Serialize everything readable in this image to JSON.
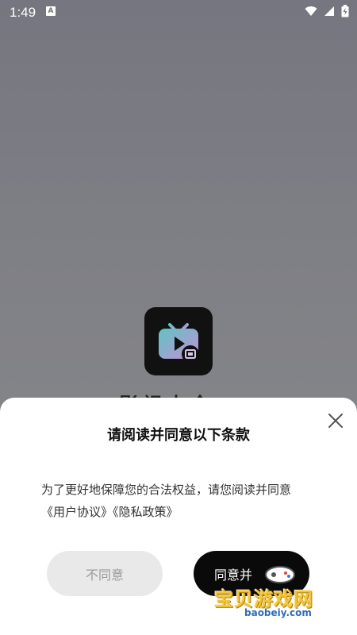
{
  "status_bar": {
    "time": "1:49",
    "notification_icon": "a-square-icon",
    "wifi_icon": "wifi-icon",
    "signal_icon": "signal-icon",
    "battery_icon": "battery-charging-icon"
  },
  "splash": {
    "app_icon": "tv-play-icon",
    "app_name_partial": "影视大全"
  },
  "dialog": {
    "title": "请阅读并同意以下条款",
    "body_line1": "为了更好地保障您的合法权益，请您阅读并同意",
    "link_user_agreement": "《用户协议》",
    "link_privacy_policy": "《隐私政策》",
    "disagree_label": "不同意",
    "agree_label": "同意并",
    "close_icon": "close-icon"
  },
  "watermark": {
    "title": "宝贝游戏网",
    "url": "baobeiy.com"
  }
}
